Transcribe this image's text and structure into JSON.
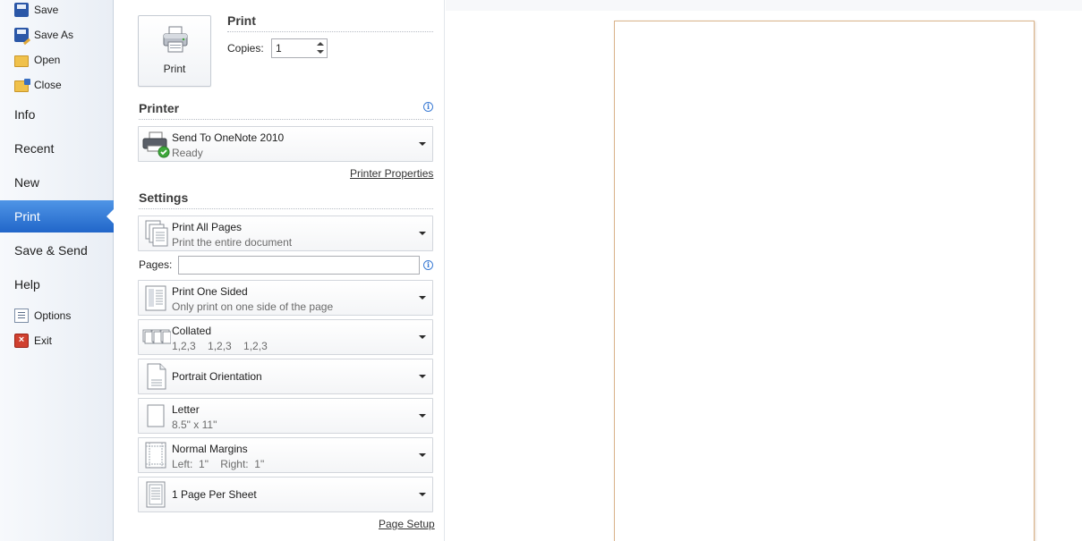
{
  "nav": {
    "save": "Save",
    "save_as": "Save As",
    "open": "Open",
    "close": "Close",
    "info": "Info",
    "recent": "Recent",
    "new": "New",
    "print": "Print",
    "save_send": "Save & Send",
    "help": "Help",
    "options": "Options",
    "exit": "Exit"
  },
  "print_section": {
    "button_label": "Print",
    "title": "Print",
    "copies_label": "Copies:",
    "copies_value": "1"
  },
  "printer": {
    "title": "Printer",
    "name": "Send To OneNote 2010",
    "status": "Ready",
    "properties_link": "Printer Properties"
  },
  "settings": {
    "title": "Settings",
    "print_all_pages": {
      "main": "Print All Pages",
      "sub": "Print the entire document"
    },
    "pages_label": "Pages:",
    "pages_value": "",
    "sided": {
      "main": "Print One Sided",
      "sub": "Only print on one side of the page"
    },
    "collated": {
      "main": "Collated",
      "sub": "1,2,3    1,2,3    1,2,3"
    },
    "orientation": {
      "main": "Portrait Orientation"
    },
    "paper": {
      "main": "Letter",
      "sub": "8.5\" x 11\""
    },
    "margins": {
      "main": "Normal Margins",
      "sub": "Left:  1\"    Right:  1\""
    },
    "per_sheet": {
      "main": "1 Page Per Sheet"
    },
    "page_setup_link": "Page Setup"
  },
  "colors": {
    "active_nav": "#2f78d8",
    "preview_border": "#d9b38b"
  }
}
